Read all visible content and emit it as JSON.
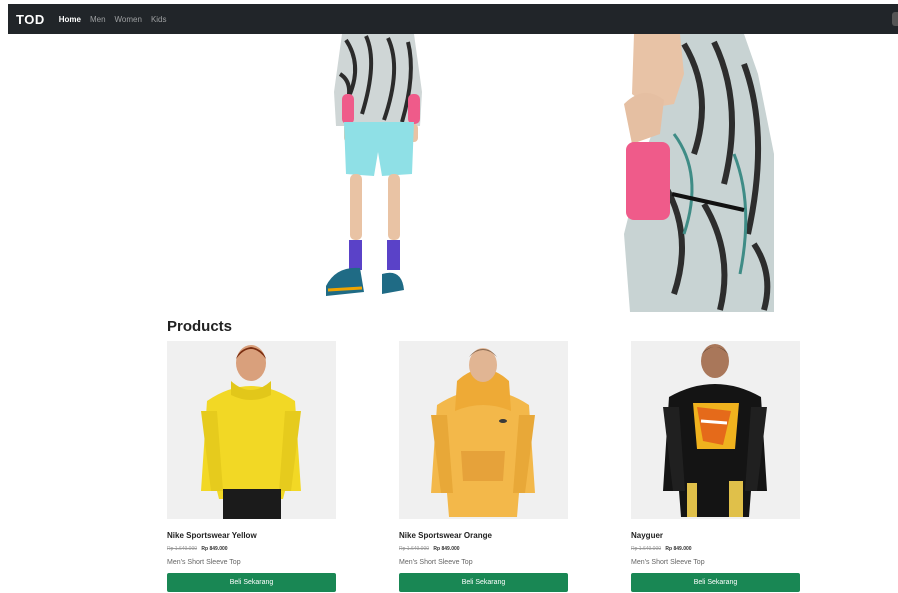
{
  "navbar": {
    "brand": "TOD",
    "links": [
      {
        "label": "Home",
        "active": true
      },
      {
        "label": "Men",
        "active": false
      },
      {
        "label": "Women",
        "active": false
      },
      {
        "label": "Kids",
        "active": false
      }
    ]
  },
  "section": {
    "title": "Products"
  },
  "products": [
    {
      "name": "Nike Sportswear Yellow",
      "price_old": "Rp 1.649.000",
      "price_new": "Rp 849.000",
      "category": "Men's Short Sleeve Top",
      "button_label": "Beli Sekarang",
      "image_icon": "yellow-hoodie"
    },
    {
      "name": "Nike Sportswear Orange",
      "price_old": "Rp 1.649.000",
      "price_new": "Rp 849.000",
      "category": "Men's Short Sleeve Top",
      "button_label": "Beli Sekarang",
      "image_icon": "orange-hoodie"
    },
    {
      "name": "Nayguer",
      "price_old": "Rp 1.649.000",
      "price_new": "Rp 849.000",
      "category": "Men's Short Sleeve Top",
      "button_label": "Beli Sekarang",
      "image_icon": "black-hoodie"
    }
  ],
  "colors": {
    "navbar_bg": "#212529",
    "button_bg": "#198754",
    "button_text": "#ffffff"
  }
}
